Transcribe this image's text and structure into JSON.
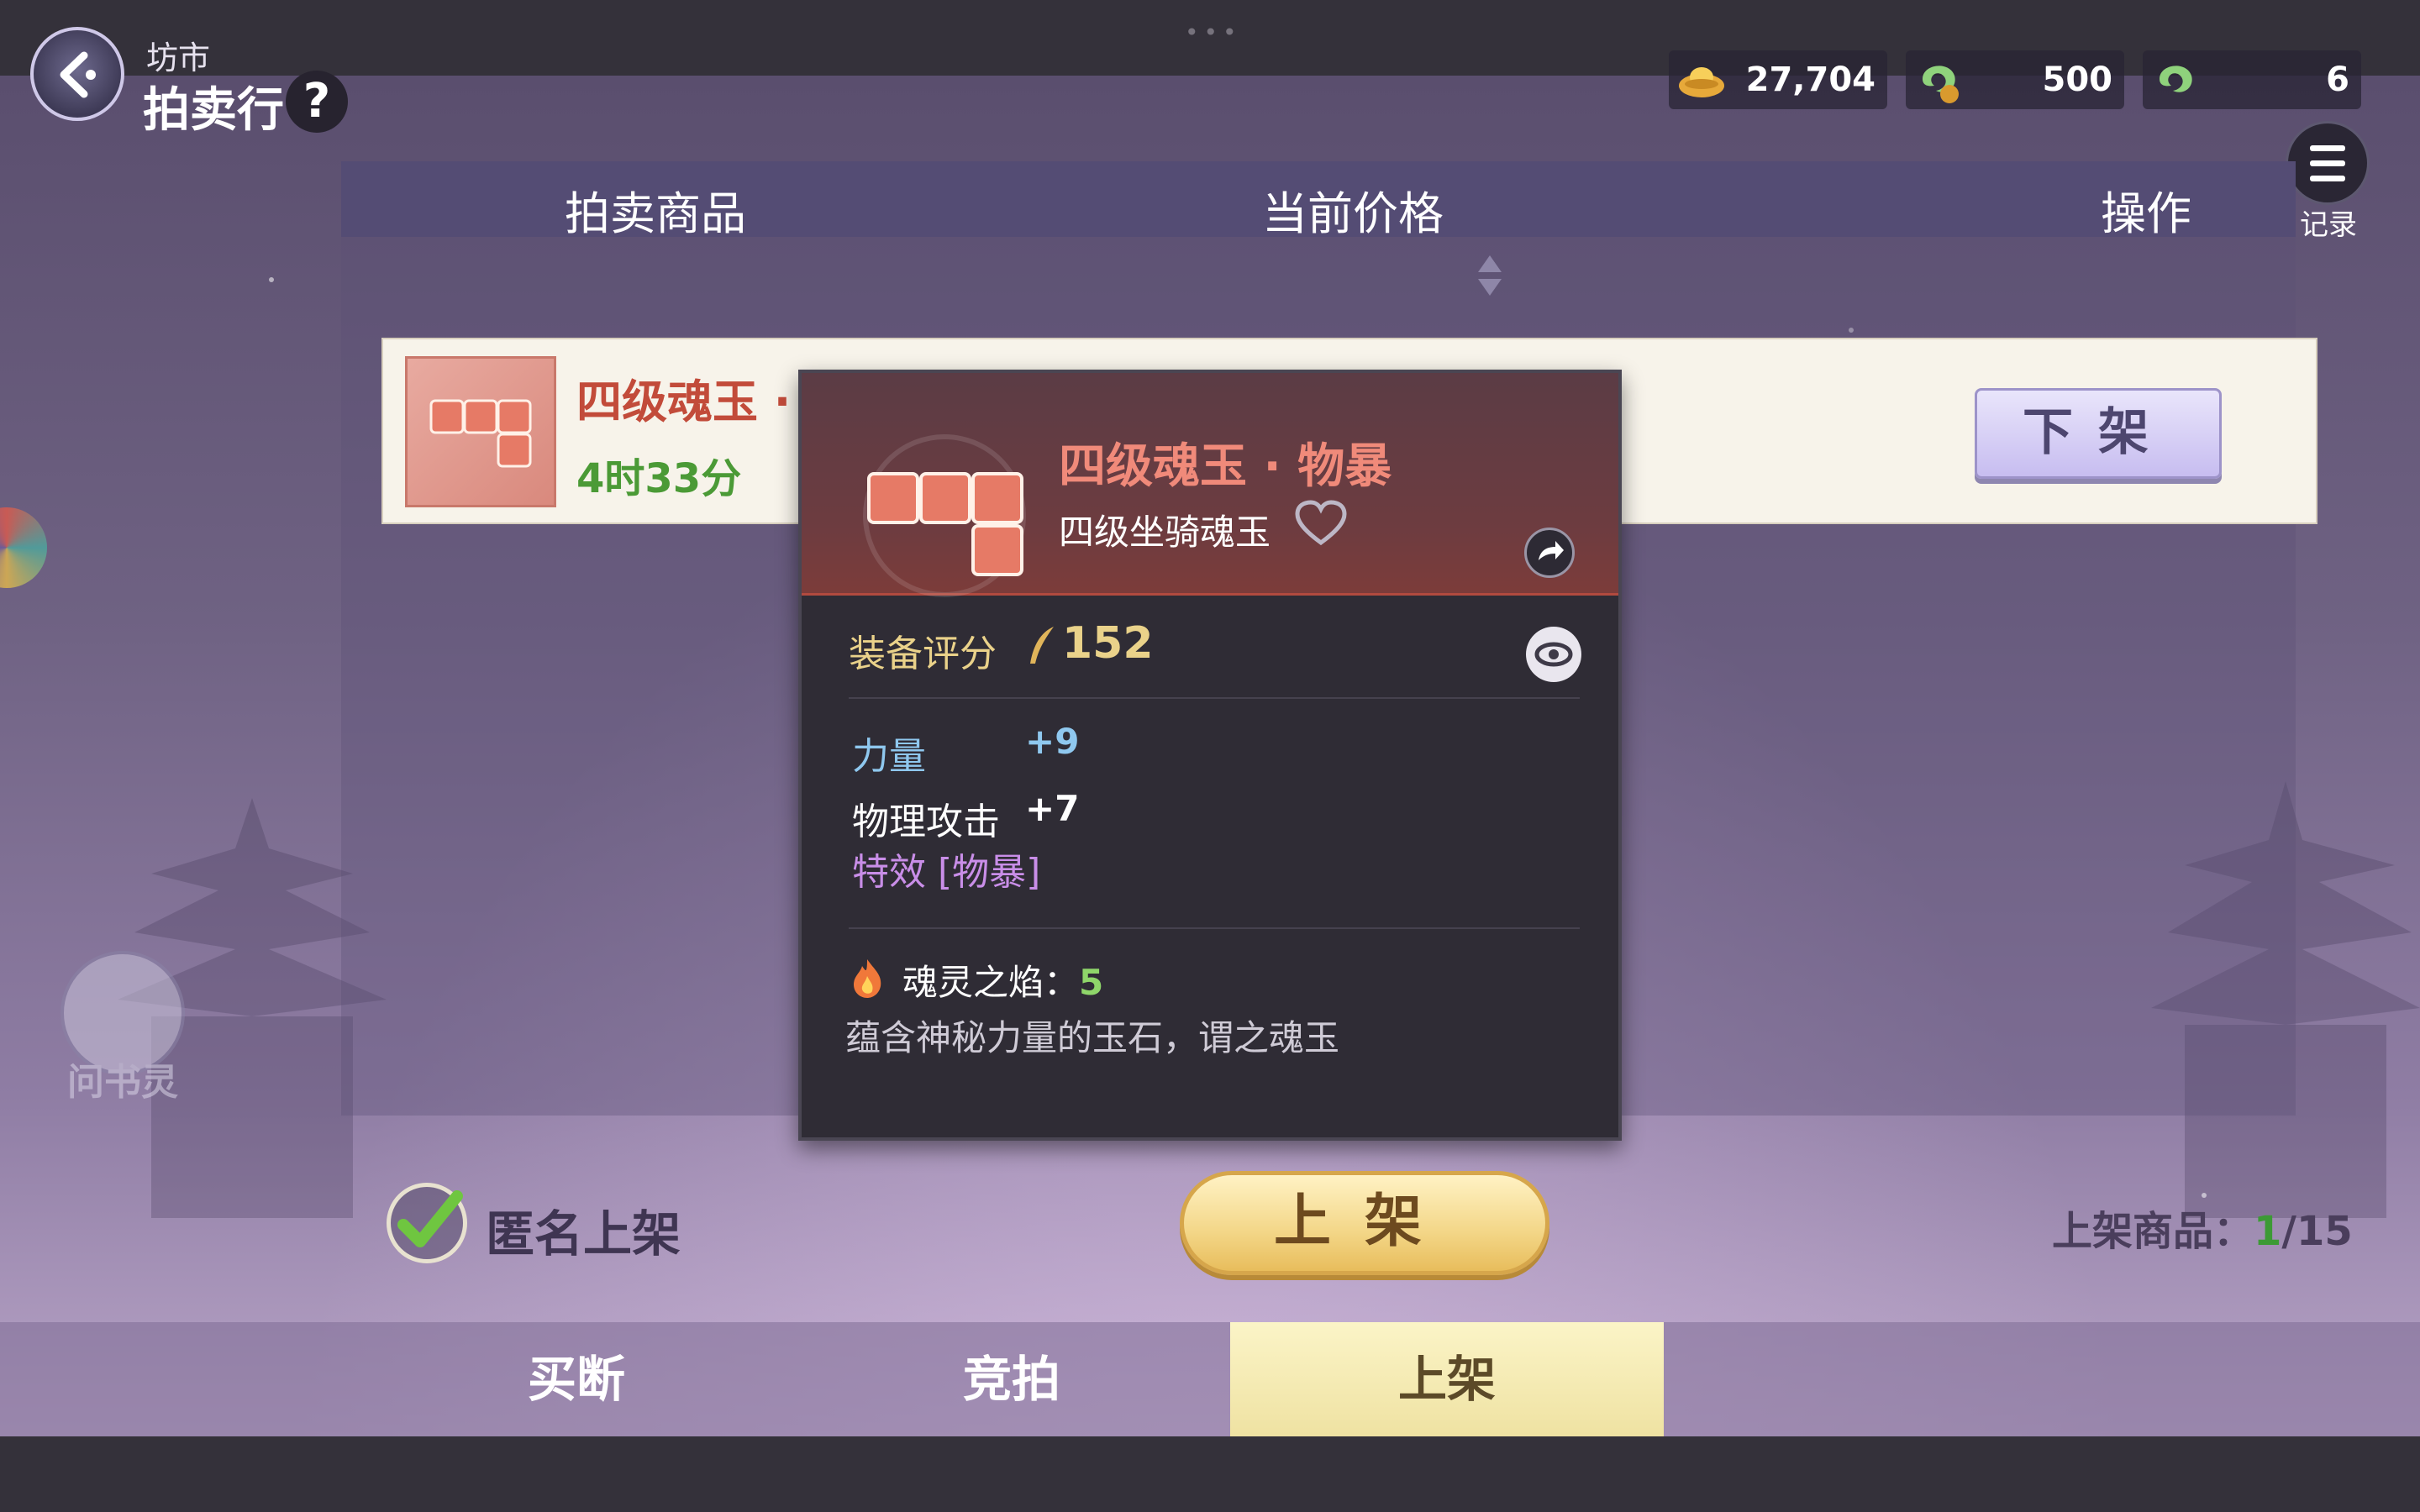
{
  "header": {
    "breadcrumb": "坊市",
    "title": "拍卖行",
    "help": "?"
  },
  "currencies": [
    {
      "icon": "gold-ingot-icon",
      "value": "27,704"
    },
    {
      "icon": "bound-jade-icon",
      "value": "500"
    },
    {
      "icon": "jade-icon",
      "value": "6"
    }
  ],
  "record": {
    "label": "记录"
  },
  "table": {
    "col_item": "拍卖商品",
    "col_price": "当前价格",
    "col_action": "操作"
  },
  "listing": {
    "name": "四级魂玉 · 物暴",
    "time_left": "4时33分",
    "delist_label": "下架"
  },
  "tooltip": {
    "name": "四级魂玉 · 物暴",
    "subtitle": "四级坐骑魂玉",
    "score_label": "装备评分",
    "score_value": "152",
    "stats": [
      {
        "label": "力量",
        "value": "+9",
        "label_color": "#8fc8ef",
        "value_color": "#8fc8ef"
      },
      {
        "label": "物理攻击",
        "value": "+7",
        "label_color": "#ffffff",
        "value_color": "#ffffff"
      }
    ],
    "effect": "特效 [物暴]",
    "soul_label": "魂灵之焰：",
    "soul_value": "5",
    "description": "蕴含神秘力量的玉石，谓之魂玉"
  },
  "footer": {
    "anonymous_label": "匿名上架",
    "list_button": "上架",
    "count_label": "上架商品：",
    "count_current": "1",
    "count_total": "/15"
  },
  "tabs": [
    {
      "label": "买断",
      "active": false
    },
    {
      "label": "竞拍",
      "active": false
    },
    {
      "label": "上架",
      "active": true
    }
  ],
  "assistant": {
    "label": "问书灵"
  }
}
